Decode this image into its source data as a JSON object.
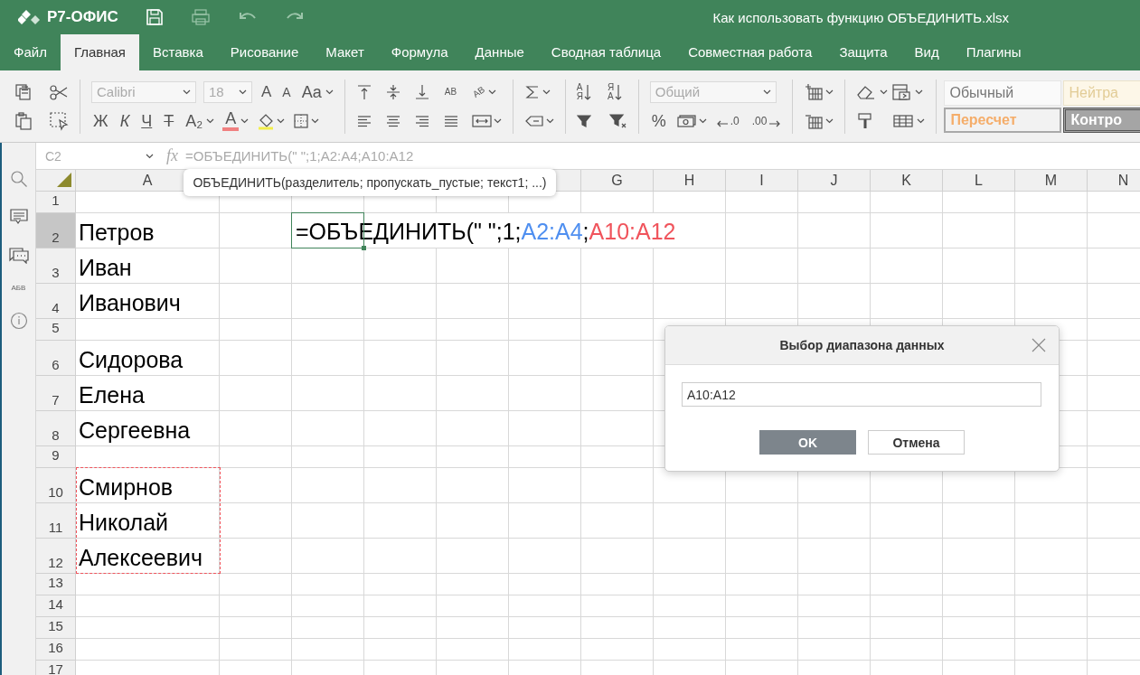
{
  "app": {
    "logo": "Р7-ОФИС",
    "title": "Как использовать функцию ОБЪЕДИНИТЬ.xlsx"
  },
  "tabs": [
    {
      "label": "Файл",
      "selected": false
    },
    {
      "label": "Главная",
      "selected": true
    },
    {
      "label": "Вставка",
      "selected": false
    },
    {
      "label": "Рисование",
      "selected": false
    },
    {
      "label": "Макет",
      "selected": false
    },
    {
      "label": "Формула",
      "selected": false
    },
    {
      "label": "Данные",
      "selected": false
    },
    {
      "label": "Сводная таблица",
      "selected": false
    },
    {
      "label": "Совместная работа",
      "selected": false
    },
    {
      "label": "Защита",
      "selected": false
    },
    {
      "label": "Вид",
      "selected": false
    },
    {
      "label": "Плагины",
      "selected": false
    }
  ],
  "toolbar": {
    "font": "Calibri",
    "size": "18",
    "grow": "A",
    "shrink": "A",
    "case": "Aa",
    "bold": "Ж",
    "italic": "К",
    "underline": "Ч",
    "strike": "T",
    "subscript": "A₂",
    "font_color": "A",
    "wrap": "AB",
    "orientation": "AB",
    "sort_asc": [
      "А",
      "Я"
    ],
    "sort_desc": [
      "Я",
      "А"
    ],
    "number_format": "Общий",
    "percent": "%",
    "decrease_decimal": ".0",
    "increase_decimal": ".00",
    "styles": [
      {
        "label": "Обычный",
        "kind": "normal"
      },
      {
        "label": "Нейтра",
        "kind": "neutral"
      },
      {
        "label": "Пересчет",
        "kind": "calculation"
      },
      {
        "label": "Контро",
        "kind": "check"
      }
    ]
  },
  "sidebar": {
    "spell_label": "АБВ"
  },
  "formula_bar": {
    "cell_name": "C2",
    "fx": "fx",
    "formula": "=ОБЪЕДИНИТЬ(\" \";1;A2:A4;A10:A12"
  },
  "tooltip": "ОБЪЕДИНИТЬ(разделитель; пропускать_пустые; текст1; ...)",
  "sheet": {
    "columns": [
      {
        "kind": "header",
        "label": "A"
      },
      {
        "kind": "covered"
      },
      {
        "kind": "covered"
      },
      {
        "kind": "covered"
      },
      {
        "kind": "covered"
      },
      {
        "kind": "partial"
      },
      {
        "kind": "header",
        "label": "G"
      },
      {
        "kind": "header",
        "label": "H"
      },
      {
        "kind": "header",
        "label": "I"
      },
      {
        "kind": "header",
        "label": "J"
      },
      {
        "kind": "header",
        "label": "K"
      },
      {
        "kind": "header",
        "label": "L"
      },
      {
        "kind": "header",
        "label": "M"
      },
      {
        "kind": "header",
        "label": "N"
      }
    ],
    "rows": [
      {
        "number": "1",
        "kind": "short",
        "selected": false,
        "marked": false
      },
      {
        "number": "2",
        "kind": "tall",
        "text": "Петров",
        "selected": true,
        "marked": false
      },
      {
        "number": "3",
        "kind": "tall",
        "text": "Иван",
        "selected": false,
        "marked": false
      },
      {
        "number": "4",
        "kind": "tall",
        "text": "Иванович",
        "selected": false,
        "marked": false
      },
      {
        "number": "5",
        "kind": "short",
        "selected": false,
        "marked": false
      },
      {
        "number": "6",
        "kind": "tall",
        "text": "Сидорова",
        "selected": false,
        "marked": false
      },
      {
        "number": "7",
        "kind": "tall",
        "text": "Елена",
        "selected": false,
        "marked": false
      },
      {
        "number": "8",
        "kind": "tall",
        "text": "Сергеевна",
        "selected": false,
        "marked": false
      },
      {
        "number": "9",
        "kind": "short",
        "selected": false,
        "marked": false
      },
      {
        "number": "10",
        "kind": "tall",
        "text": "Смирнов",
        "selected": false,
        "marked": true
      },
      {
        "number": "11",
        "kind": "tall",
        "text": "Николай",
        "selected": false,
        "marked": true
      },
      {
        "number": "12",
        "kind": "tall",
        "text": "Алексеевич",
        "selected": false,
        "marked": true
      },
      {
        "number": "13",
        "kind": "short",
        "selected": false,
        "marked": false
      },
      {
        "number": "14",
        "kind": "short",
        "selected": false,
        "marked": false
      },
      {
        "number": "15",
        "kind": "short",
        "selected": false,
        "marked": false
      },
      {
        "number": "16",
        "kind": "short",
        "selected": false,
        "marked": false
      },
      {
        "number": "17",
        "kind": "short",
        "selected": false,
        "marked": false
      }
    ],
    "editor": [
      {
        "text": "=ОБЪЕДИНИТЬ(\" \";1;"
      },
      {
        "text": "A2:A4",
        "color": "#4f8ff0"
      },
      {
        "text": ";"
      },
      {
        "text": "A10:A12",
        "color": "#f0545c"
      }
    ]
  },
  "dialog": {
    "title": "Выбор диапазона данных",
    "value": "A10:A12",
    "ok": "OK",
    "cancel": "Отмена"
  }
}
